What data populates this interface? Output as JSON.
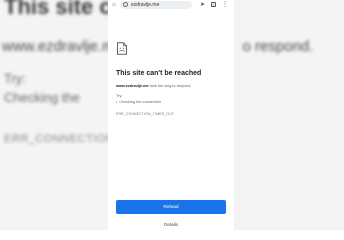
{
  "background": {
    "title": "This site c",
    "url_line": "www.ezdravlje.m",
    "url_suffix": "o respond.",
    "try": "Try:",
    "checking": "Checking the",
    "error": "ERR_CONNECTION_"
  },
  "browser": {
    "url": "ezdravlje.me",
    "icons": [
      "home-icon",
      "tune-icon",
      "share-icon",
      "tabs-icon",
      "menu-icon"
    ],
    "tab_count": "1"
  },
  "error_page": {
    "icon": "broken-document-icon",
    "title": "This site can't be reached",
    "host": "www.ezdravlje.me",
    "message": " took too long to respond.",
    "try_label": "Try:",
    "suggestion": "Checking the connection",
    "error_code": "ERR_CONNECTION_TIMED_OUT",
    "reload_label": "Reload",
    "details_label": "Details"
  },
  "colors": {
    "accent": "#1a73e8",
    "title_text": "#202124",
    "secondary_text": "#5f6368"
  }
}
